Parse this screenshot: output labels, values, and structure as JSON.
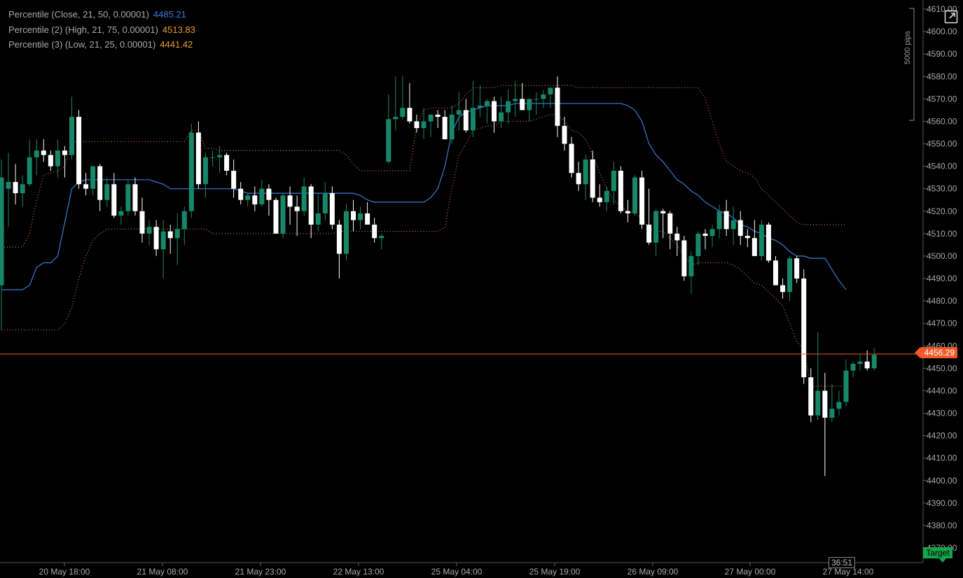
{
  "legend": {
    "row1_name": "Percentile (Close, 21, 50, 0.00001)",
    "row1_value": "4485.21",
    "row2_name": "Percentile (2) (High, 21, 75, 0.00001)",
    "row2_value": "4513.83",
    "row3_name": "Percentile (3) (Low, 21, 25, 0.00001)",
    "row3_value": "4441.42"
  },
  "price_tag": "4456.29",
  "target_label": "Target",
  "countdown": "36:51",
  "pips_label": "5000 pips",
  "colors": {
    "background": "#000000",
    "bull": "#17876a",
    "bear": "#ffffff",
    "close_line": "#3a7bd5",
    "dotted_bands": "#c98a2e",
    "price_line": "#f05a28",
    "axis_text": "#a9a9a9",
    "legend_close_value": "#3a7bd5",
    "legend_high_value": "#e89b2e",
    "legend_low_value": "#e89b2e"
  },
  "icons": {
    "expand": "expand-icon"
  },
  "chart_data": {
    "type": "candlestick",
    "ylim": [
      4370,
      4610
    ],
    "y_ticks": [
      "4370.00",
      "4380.00",
      "4390.00",
      "4400.00",
      "4410.00",
      "4420.00",
      "4430.00",
      "4440.00",
      "4450.00",
      "4460.00",
      "4470.00",
      "4480.00",
      "4490.00",
      "4500.00",
      "4510.00",
      "4520.00",
      "4530.00",
      "4540.00",
      "4550.00",
      "4560.00",
      "4570.00",
      "4580.00",
      "4590.00",
      "4600.00",
      "4610.00"
    ],
    "x_labels": [
      "20 May 18:00",
      "21 May 08:00",
      "21 May 23:00",
      "22 May 13:00",
      "25 May 04:00",
      "25 May 19:00",
      "26 May 09:00",
      "27 May 00:00",
      "27 May 14:00"
    ],
    "current_price": 4456.29,
    "candles": [
      [
        4487,
        4543,
        4467,
        4535
      ],
      [
        4530,
        4546,
        4513,
        4533
      ],
      [
        4533,
        4541,
        4523,
        4528
      ],
      [
        4528,
        4536,
        4522,
        4532
      ],
      [
        4532,
        4552,
        4531,
        4544
      ],
      [
        4544,
        4552,
        4536,
        4547
      ],
      [
        4547,
        4552,
        4542,
        4545
      ],
      [
        4545,
        4547,
        4538,
        4540
      ],
      [
        4540,
        4552,
        4535,
        4547
      ],
      [
        4547,
        4549,
        4535,
        4545
      ],
      [
        4545,
        4571,
        4543,
        4562
      ],
      [
        4562,
        4565,
        4530,
        4532
      ],
      [
        4532,
        4537,
        4527,
        4530
      ],
      [
        4530,
        4540,
        4527,
        4540
      ],
      [
        4540,
        4541,
        4520,
        4525
      ],
      [
        4525,
        4535,
        4522,
        4532
      ],
      [
        4532,
        4537,
        4517,
        4518
      ],
      [
        4518,
        4522,
        4514,
        4520
      ],
      [
        4520,
        4534,
        4518,
        4532
      ],
      [
        4532,
        4535,
        4518,
        4520
      ],
      [
        4520,
        4526,
        4506,
        4510
      ],
      [
        4510,
        4516,
        4505,
        4513
      ],
      [
        4513,
        4516,
        4500,
        4503
      ],
      [
        4503,
        4516,
        4490,
        4511
      ],
      [
        4511,
        4514,
        4501,
        4508
      ],
      [
        4508,
        4519,
        4496,
        4512
      ],
      [
        4512,
        4522,
        4505,
        4520
      ],
      [
        4520,
        4559,
        4517,
        4555
      ],
      [
        4555,
        4560,
        4530,
        4532
      ],
      [
        4532,
        4546,
        4526,
        4544
      ],
      [
        4544,
        4547,
        4540,
        4544
      ],
      [
        4544,
        4549,
        4537,
        4545
      ],
      [
        4545,
        4546,
        4536,
        4538
      ],
      [
        4538,
        4543,
        4526,
        4530
      ],
      [
        4530,
        4533,
        4523,
        4525
      ],
      [
        4525,
        4528,
        4522,
        4527
      ],
      [
        4527,
        4531,
        4520,
        4523
      ],
      [
        4523,
        4534,
        4522,
        4530
      ],
      [
        4530,
        4532,
        4518,
        4525
      ],
      [
        4525,
        4526,
        4510,
        4510
      ],
      [
        4510,
        4528,
        4508,
        4527
      ],
      [
        4527,
        4531,
        4514,
        4522
      ],
      [
        4522,
        4527,
        4509,
        4520
      ],
      [
        4520,
        4535,
        4518,
        4531
      ],
      [
        4531,
        4532,
        4508,
        4514
      ],
      [
        4514,
        4528,
        4511,
        4519
      ],
      [
        4519,
        4533,
        4516,
        4528
      ],
      [
        4528,
        4531,
        4512,
        4514
      ],
      [
        4514,
        4516,
        4490,
        4501
      ],
      [
        4501,
        4523,
        4498,
        4520
      ],
      [
        4520,
        4525,
        4511,
        4516
      ],
      [
        4516,
        4522,
        4512,
        4519
      ],
      [
        4519,
        4524,
        4514,
        4514
      ],
      [
        4514,
        4517,
        4506,
        4508
      ],
      [
        4508,
        4510,
        4503,
        4509
      ],
      [
        4542,
        4572,
        4541,
        4561
      ],
      [
        4561,
        4580,
        4556,
        4562
      ],
      [
        4562,
        4580,
        4561,
        4566
      ],
      [
        4566,
        4577,
        4559,
        4560
      ],
      [
        4560,
        4563,
        4555,
        4557
      ],
      [
        4557,
        4566,
        4552,
        4560
      ],
      [
        4560,
        4563,
        4553,
        4563
      ],
      [
        4563,
        4565,
        4557,
        4562
      ],
      [
        4562,
        4565,
        4552,
        4552
      ],
      [
        4552,
        4567,
        4550,
        4563
      ],
      [
        4563,
        4573,
        4556,
        4565
      ],
      [
        4565,
        4570,
        4555,
        4556
      ],
      [
        4556,
        4578,
        4553,
        4566
      ],
      [
        4566,
        4576,
        4562,
        4567
      ],
      [
        4567,
        4570,
        4559,
        4569
      ],
      [
        4569,
        4571,
        4555,
        4560
      ],
      [
        4560,
        4571,
        4557,
        4564
      ],
      [
        4564,
        4574,
        4559,
        4569
      ],
      [
        4569,
        4578,
        4562,
        4570
      ],
      [
        4570,
        4577,
        4565,
        4565
      ],
      [
        4565,
        4570,
        4560,
        4570
      ],
      [
        4570,
        4573,
        4563,
        4570
      ],
      [
        4570,
        4574,
        4566,
        4572
      ],
      [
        4572,
        4574,
        4566,
        4575
      ],
      [
        4575,
        4580,
        4553,
        4558
      ],
      [
        4558,
        4562,
        4547,
        4550
      ],
      [
        4550,
        4553,
        4535,
        4537
      ],
      [
        4537,
        4542,
        4529,
        4532
      ],
      [
        4532,
        4545,
        4525,
        4543
      ],
      [
        4543,
        4547,
        4524,
        4526
      ],
      [
        4526,
        4532,
        4522,
        4524
      ],
      [
        4524,
        4531,
        4520,
        4529
      ],
      [
        4529,
        4542,
        4523,
        4538
      ],
      [
        4538,
        4540,
        4519,
        4520
      ],
      [
        4520,
        4525,
        4515,
        4519
      ],
      [
        4519,
        4536,
        4518,
        4535
      ],
      [
        4535,
        4538,
        4512,
        4514
      ],
      [
        4514,
        4530,
        4505,
        4506
      ],
      [
        4506,
        4521,
        4500,
        4520
      ],
      [
        4520,
        4521,
        4508,
        4519
      ],
      [
        4519,
        4520,
        4503,
        4510
      ],
      [
        4510,
        4513,
        4500,
        4507
      ],
      [
        4507,
        4509,
        4489,
        4491
      ],
      [
        4491,
        4502,
        4483,
        4500
      ],
      [
        4500,
        4511,
        4496,
        4510
      ],
      [
        4510,
        4512,
        4503,
        4509
      ],
      [
        4509,
        4514,
        4504,
        4512
      ],
      [
        4512,
        4523,
        4508,
        4520
      ],
      [
        4520,
        4525,
        4509,
        4512
      ],
      [
        4512,
        4522,
        4505,
        4516
      ],
      [
        4516,
        4520,
        4505,
        4509
      ],
      [
        4509,
        4512,
        4504,
        4508
      ],
      [
        4508,
        4516,
        4500,
        4500
      ],
      [
        4500,
        4516,
        4498,
        4514
      ],
      [
        4514,
        4515,
        4497,
        4498
      ],
      [
        4498,
        4500,
        4490,
        4487
      ],
      [
        4487,
        4490,
        4481,
        4484
      ],
      [
        4484,
        4500,
        4480,
        4499
      ],
      [
        4499,
        4500,
        4488,
        4490
      ],
      [
        4490,
        4494,
        4443,
        4446
      ],
      [
        4446,
        4450,
        4426,
        4429
      ],
      [
        4429,
        4466,
        4427,
        4440
      ],
      [
        4440,
        4448,
        4402,
        4428
      ],
      [
        4428,
        4443,
        4426,
        4432
      ],
      [
        4432,
        4440,
        4429,
        4435
      ],
      [
        4435,
        4454,
        4433,
        4449
      ],
      [
        4449,
        4453,
        4446,
        4452
      ],
      [
        4452,
        4456,
        4449,
        4453
      ],
      [
        4453,
        4458,
        4449,
        4450
      ],
      [
        4450,
        4459,
        4449,
        4456
      ]
    ],
    "series": [
      {
        "name": "Percentile (Close, 21, 50, 0.00001)",
        "values": [
          4485,
          4485,
          4485,
          4485,
          4487,
          4495,
          4497,
          4497,
          4500,
          4515,
          4530,
          4533,
          4534,
          4534,
          4534,
          4534,
          4534,
          4534,
          4534,
          4534,
          4534,
          4534,
          4533,
          4532,
          4530,
          4530,
          4530,
          4530,
          4530,
          4530,
          4530,
          4530,
          4530,
          4530,
          4529,
          4528,
          4528,
          4528,
          4528,
          4528,
          4528,
          4528,
          4528,
          4528,
          4528,
          4528,
          4528,
          4528,
          4528,
          4528,
          4528,
          4527,
          4525,
          4524,
          4524,
          4524,
          4524,
          4524,
          4524,
          4524,
          4524,
          4526,
          4530,
          4540,
          4555,
          4562,
          4564,
          4565,
          4566,
          4567,
          4567,
          4567,
          4567,
          4568,
          4568,
          4568,
          4568,
          4568,
          4568,
          4568,
          4568,
          4568,
          4568,
          4568,
          4568,
          4568,
          4568,
          4568,
          4568,
          4567,
          4565,
          4560,
          4550,
          4545,
          4542,
          4538,
          4534,
          4532,
          4529,
          4527,
          4524,
          4522,
          4520,
          4519,
          4517,
          4514,
          4513,
          4511,
          4510,
          4508,
          4507,
          4505,
          4502,
          4500,
          4500,
          4499,
          4499,
          4499,
          4494,
          4489,
          4485
        ]
      },
      {
        "name": "Percentile (2) (High, 21, 75, 0.00001)",
        "values": [
          4504,
          4504,
          4504,
          4504,
          4510,
          4525,
          4536,
          4537,
          4538,
          4540,
          4551,
          4551,
          4551,
          4551,
          4551,
          4551,
          4551,
          4551,
          4551,
          4551,
          4551,
          4551,
          4551,
          4551,
          4551,
          4551,
          4551,
          4556,
          4556,
          4548,
          4548,
          4547,
          4547,
          4547,
          4547,
          4547,
          4547,
          4547,
          4547,
          4547,
          4547,
          4547,
          4547,
          4547,
          4547,
          4547,
          4547,
          4547,
          4547,
          4545,
          4541,
          4538,
          4538,
          4538,
          4538,
          4538,
          4538,
          4538,
          4538,
          4558,
          4565,
          4566,
          4566,
          4566,
          4566,
          4568,
          4572,
          4575,
          4575,
          4575,
          4575,
          4576,
          4576,
          4576,
          4576,
          4576,
          4576,
          4576,
          4576,
          4576,
          4576,
          4576,
          4575,
          4575,
          4575,
          4575,
          4575,
          4575,
          4575,
          4575,
          4575,
          4575,
          4575,
          4575,
          4575,
          4575,
          4575,
          4575,
          4575,
          4575,
          4570,
          4560,
          4550,
          4542,
          4540,
          4538,
          4537,
          4535,
          4530,
          4527,
          4524,
          4521,
          4518,
          4515,
          4514,
          4514,
          4514,
          4514,
          4514,
          4514,
          4514
        ]
      },
      {
        "name": "Percentile (3) (Low, 21, 25, 0.00001)",
        "values": [
          4467,
          4467,
          4467,
          4467,
          4467,
          4467,
          4467,
          4467,
          4467,
          4470,
          4477,
          4490,
          4500,
          4507,
          4510,
          4512,
          4512,
          4512,
          4512,
          4512,
          4512,
          4512,
          4512,
          4512,
          4512,
          4512,
          4512,
          4512,
          4512,
          4512,
          4510,
          4510,
          4510,
          4510,
          4510,
          4510,
          4510,
          4510,
          4510,
          4510,
          4510,
          4510,
          4510,
          4510,
          4510,
          4510,
          4510,
          4510,
          4511,
          4511,
          4511,
          4511,
          4511,
          4511,
          4511,
          4511,
          4511,
          4511,
          4511,
          4511,
          4511,
          4511,
          4511,
          4513,
          4530,
          4545,
          4550,
          4556,
          4557,
          4558,
          4558,
          4560,
          4560,
          4560,
          4560,
          4560,
          4561,
          4562,
          4563,
          4563,
          4560,
          4556,
          4555,
          4552,
          4545,
          4537,
          4530,
          4525,
          4522,
          4520,
          4519,
          4517,
          4512,
          4511,
          4511,
          4508,
          4505,
          4500,
          4496,
          4497,
          4497,
          4497,
          4497,
          4497,
          4496,
          4494,
          4491,
          4488,
          4487,
          4484,
          4481,
          4478,
          4470,
          4462,
          4458,
          4442,
          4442,
          4442,
          4442,
          4442,
          4442
        ]
      }
    ]
  }
}
